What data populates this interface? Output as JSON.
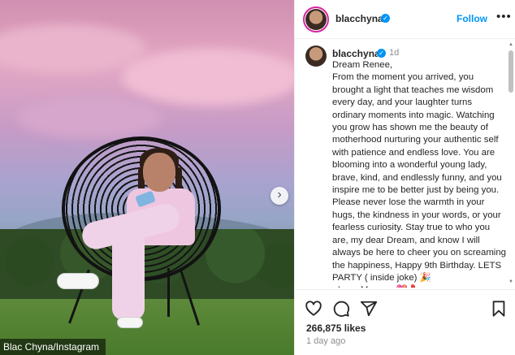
{
  "photo": {
    "credit": "Blac Chyna/Instagram",
    "next_arrow": "›"
  },
  "header": {
    "username": "blacchyna",
    "follow_label": "Follow",
    "more_label": "•••"
  },
  "caption": {
    "username": "blacchyna",
    "time": "1d",
    "text": "Dream Renee,\nFrom the moment you arrived, you brought a light that teaches me wisdom every day, and your laughter turns ordinary moments into magic. Watching you grow has shown me the beauty of motherhood nurturing your authentic self with patience and endless love. You are blooming into a wonderful young lady, brave, kind, and endlessly funny, and you inspire me to be better just by being you. Please never lose the warmth in your hugs, the kindness in your words, or your fearless curiosity. Stay true to who you are, my dear Dream, and know I will always be here to cheer you on screaming the happiness, Happy 9th Birthday. LETS PARTY ( inside joke) 🎉\n- Love Mommy 💖💄"
  },
  "actions": {
    "likes": "266,875 likes",
    "date": "1 day ago"
  },
  "icons": {
    "verified": "verified-badge",
    "like": "heart-icon",
    "comment": "comment-icon",
    "share": "share-icon",
    "save": "bookmark-icon"
  },
  "colors": {
    "accent": "#0095f6",
    "text": "#262626",
    "muted": "#8e8e8e"
  }
}
